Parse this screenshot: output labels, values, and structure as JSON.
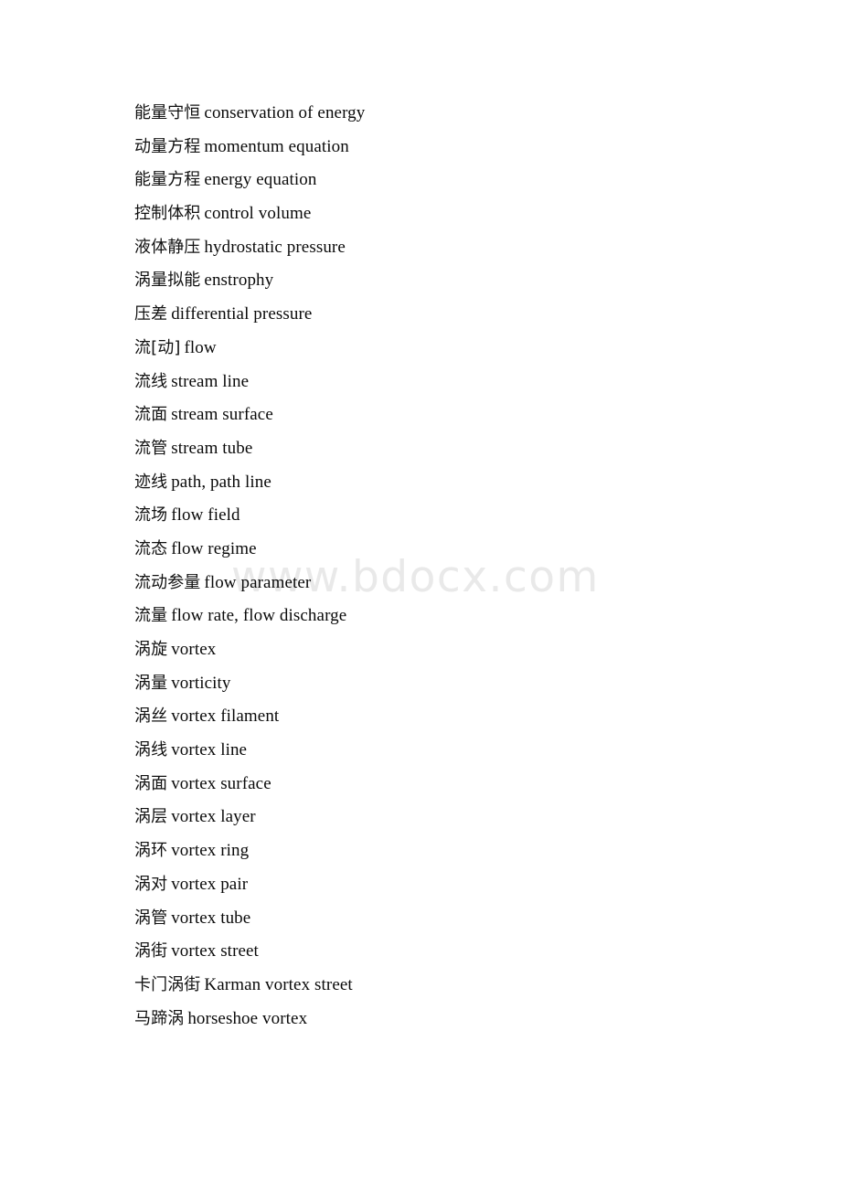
{
  "document": {
    "type": "glossary",
    "subject": "fluid mechanics terminology (Chinese-English)",
    "watermark": "www.bdocx.com",
    "watermark_color": "#e9e9e9",
    "text_color": "#0a0a0a",
    "background_color": "#ffffff"
  },
  "entries": [
    {
      "term": "能量守恒",
      "gloss": "conservation of energy"
    },
    {
      "term": "动量方程",
      "gloss": "momentum equation"
    },
    {
      "term": "能量方程",
      "gloss": "energy equation"
    },
    {
      "term": "控制体积",
      "gloss": "control volume"
    },
    {
      "term": "液体静压",
      "gloss": "hydrostatic pressure"
    },
    {
      "term": "涡量拟能",
      "gloss": "enstrophy"
    },
    {
      "term": "压差",
      "gloss": "differential pressure"
    },
    {
      "term": "流[动]",
      "gloss": "flow"
    },
    {
      "term": "流线",
      "gloss": "stream line"
    },
    {
      "term": "流面",
      "gloss": "stream surface"
    },
    {
      "term": "流管",
      "gloss": "stream tube"
    },
    {
      "term": "迹线",
      "gloss": "path, path line"
    },
    {
      "term": "流场",
      "gloss": "flow field"
    },
    {
      "term": "流态",
      "gloss": "flow regime"
    },
    {
      "term": "流动参量",
      "gloss": "flow parameter"
    },
    {
      "term": "流量",
      "gloss": "flow rate, flow discharge"
    },
    {
      "term": "涡旋",
      "gloss": "vortex"
    },
    {
      "term": "涡量",
      "gloss": "vorticity"
    },
    {
      "term": "涡丝",
      "gloss": "vortex filament"
    },
    {
      "term": "涡线",
      "gloss": "vortex line"
    },
    {
      "term": "涡面",
      "gloss": "vortex surface"
    },
    {
      "term": "涡层",
      "gloss": "vortex layer"
    },
    {
      "term": "涡环",
      "gloss": "vortex ring"
    },
    {
      "term": "涡对",
      "gloss": "vortex pair"
    },
    {
      "term": "涡管",
      "gloss": "vortex tube"
    },
    {
      "term": "涡街",
      "gloss": "vortex street"
    },
    {
      "term": "卡门涡街",
      "gloss": "Karman vortex street"
    },
    {
      "term": "马蹄涡",
      "gloss": "horseshoe vortex"
    }
  ]
}
